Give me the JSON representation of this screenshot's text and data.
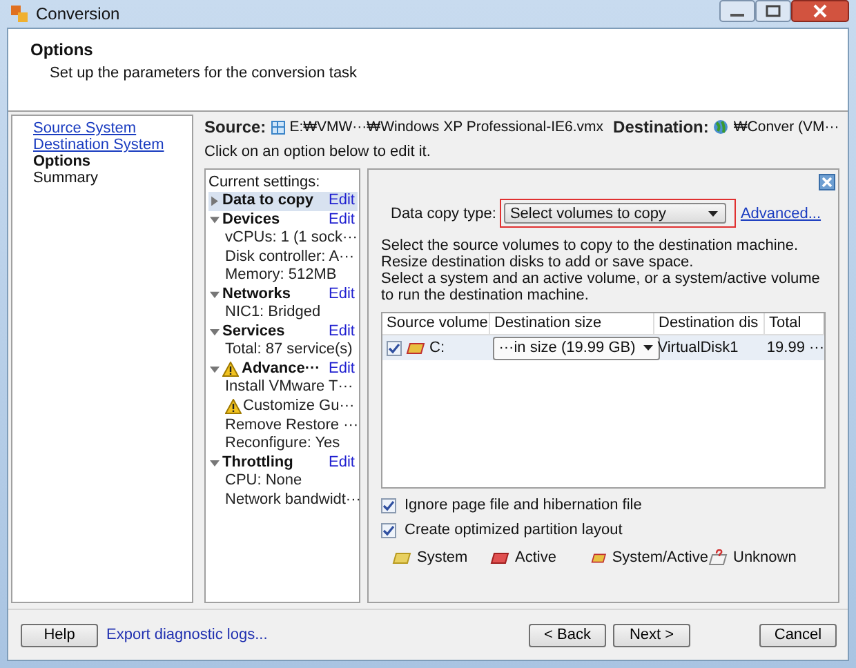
{
  "window": {
    "title": "Conversion"
  },
  "header": {
    "title": "Options",
    "subtitle": "Set up the parameters for the conversion task"
  },
  "nav": [
    {
      "label": "Source System",
      "kind": "link",
      "selected": false
    },
    {
      "label": "Destination System",
      "kind": "link",
      "selected": false
    },
    {
      "label": "Options",
      "kind": "plain",
      "selected": true
    },
    {
      "label": "Summary",
      "kind": "plain",
      "selected": false
    }
  ],
  "source": {
    "label": "Source:",
    "path": "E:₩VMW···₩Windows XP Professional-IE6.vmx"
  },
  "destination": {
    "label": "Destination:",
    "path": "₩Conver (VM···"
  },
  "instruction": "Click on an option below to edit it.",
  "settings": {
    "heading": "Current settings:",
    "groups": [
      {
        "title": "Data to copy",
        "edit": "Edit",
        "expanded": false,
        "selected": true,
        "warning": false
      },
      {
        "title": "Devices",
        "edit": "Edit",
        "expanded": true,
        "selected": false,
        "warning": false,
        "items": [
          {
            "text": "vCPUs: 1 (1 sock···",
            "warning": false
          },
          {
            "text": "Disk controller: A···",
            "warning": false
          },
          {
            "text": "Memory: 512MB",
            "warning": false
          }
        ]
      },
      {
        "title": "Networks",
        "edit": "Edit",
        "expanded": true,
        "selected": false,
        "warning": false,
        "items": [
          {
            "text": "NIC1: Bridged",
            "warning": false
          }
        ]
      },
      {
        "title": "Services",
        "edit": "Edit",
        "expanded": true,
        "selected": false,
        "warning": false,
        "items": [
          {
            "text": "Total: 87 service(s)",
            "warning": false
          }
        ]
      },
      {
        "title": "Advance···",
        "edit": "Edit",
        "expanded": true,
        "selected": false,
        "warning": true,
        "items": [
          {
            "text": "Install VMware T···",
            "warning": false
          },
          {
            "text": "Customize Gu···",
            "warning": true
          },
          {
            "text": "Remove Restore ···",
            "warning": false
          },
          {
            "text": "Reconfigure: Yes",
            "warning": false
          }
        ]
      },
      {
        "title": "Throttling",
        "edit": "Edit",
        "expanded": true,
        "selected": false,
        "warning": false,
        "items": [
          {
            "text": "CPU: None",
            "warning": false
          },
          {
            "text": "Network bandwidt···",
            "warning": false
          }
        ]
      }
    ]
  },
  "detail": {
    "copy_type_label": "Data copy type:",
    "copy_type_value": "Select volumes to copy",
    "advanced": "Advanced...",
    "description": [
      "Select the source volumes to copy to the destination machine.",
      "Resize destination disks to add or save space.",
      "Select a system and an active volume, or a system/active volume",
      "to run the destination machine."
    ],
    "table": {
      "columns": [
        "Source volume",
        "Destination size",
        "Destination dis",
        "Total"
      ],
      "rows": [
        {
          "checked": true,
          "kind": "system-active",
          "volume": "C:",
          "size": "···in size (19.99 GB)",
          "disk": "VirtualDisk1",
          "total": "19.99 ···"
        }
      ]
    },
    "options": [
      {
        "label": "Ignore page file and hibernation file",
        "checked": true
      },
      {
        "label": "Create optimized partition layout",
        "checked": true
      }
    ],
    "legend": [
      {
        "label": "System",
        "kind": "system"
      },
      {
        "label": "Active",
        "kind": "active"
      },
      {
        "label": "System/Active",
        "kind": "system-active"
      },
      {
        "label": "Unknown",
        "kind": "unknown"
      }
    ]
  },
  "footer": {
    "help": "Help",
    "export": "Export diagnostic logs...",
    "back": "< Back",
    "next": "Next >",
    "cancel": "Cancel"
  }
}
